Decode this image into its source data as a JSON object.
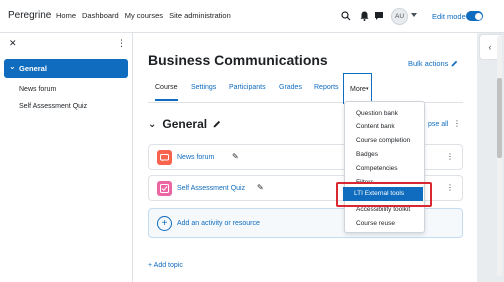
{
  "navbar": {
    "brand": "Peregrine",
    "links": [
      "Home",
      "Dashboard",
      "My courses",
      "Site administration"
    ],
    "avatar": "AU",
    "edit_mode_label": "Edit mode"
  },
  "drawer": {
    "active_section": "General",
    "items": [
      "News forum",
      "Self Assessment Quiz"
    ]
  },
  "course": {
    "title": "Business Communications",
    "bulk_actions": "Bulk actions",
    "tabs": [
      "Course",
      "Settings",
      "Participants",
      "Grades",
      "Reports"
    ],
    "more_tab": "More",
    "section_title": "General",
    "collapse_all": "pse all",
    "activities": [
      "News forum",
      "Self Assessment Quiz"
    ],
    "add_activity": "Add an activity or resource",
    "add_topic": "+ Add topic"
  },
  "more_menu": {
    "items": [
      "Question bank",
      "Content bank",
      "Course completion",
      "Badges",
      "Competencies",
      "Filters",
      "LTI External tools",
      "Accessibility toolkit",
      "Course reuse"
    ],
    "highlighted": "LTI External tools"
  },
  "colors": {
    "primary": "#0f6cbf",
    "highlight_border": "#d9282f",
    "forum_icon": "#f7634d",
    "quiz_icon": "#eb66a2"
  }
}
